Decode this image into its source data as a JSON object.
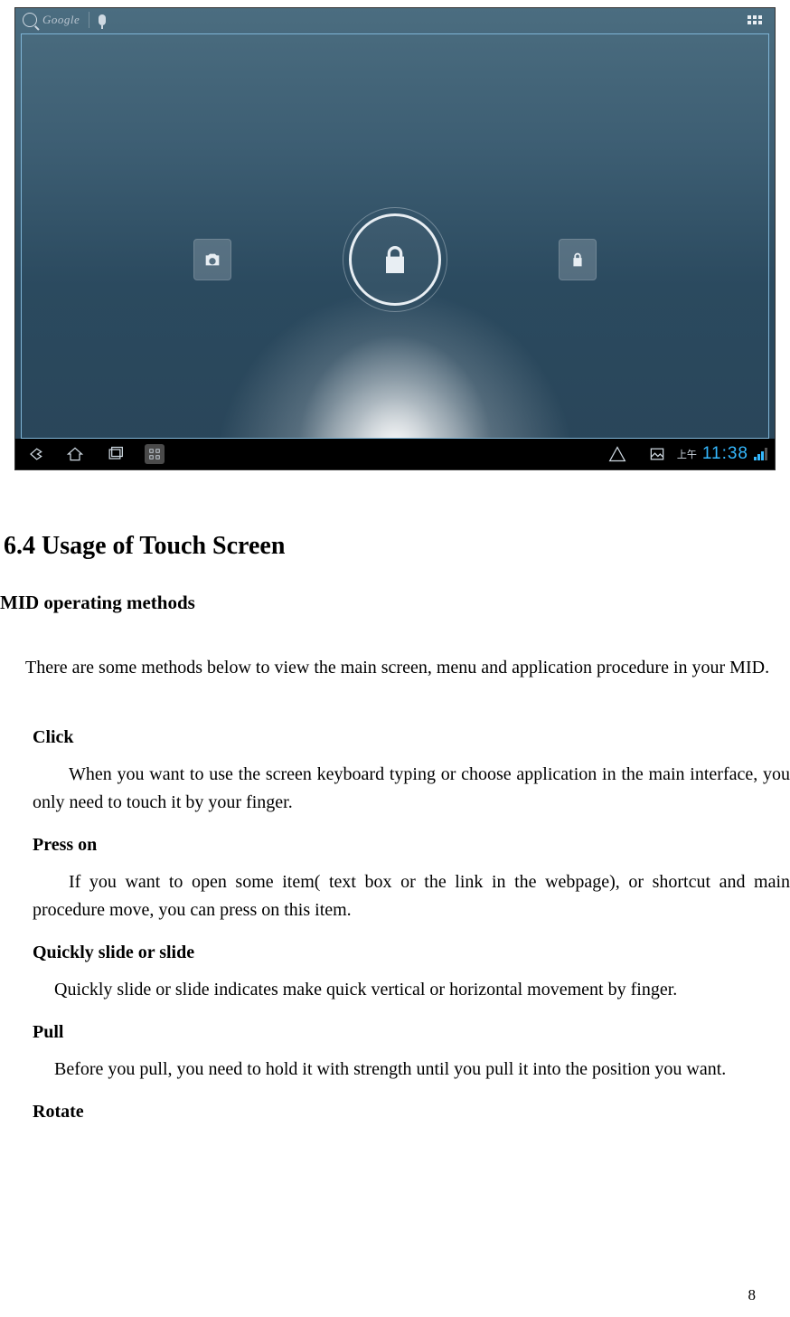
{
  "screenshot": {
    "search_brand": "Google",
    "clock_prefix": "上午",
    "time": "11:38"
  },
  "doc": {
    "section_title": "6.4 Usage of Touch Screen",
    "subheading": "MID operating methods",
    "intro": "There are some methods below to view the main screen, menu and application procedure in your MID.",
    "methods": [
      {
        "title": "Click",
        "body": "When you want to use the screen keyboard typing or choose application in the main interface, you only need to touch it by your finger."
      },
      {
        "title": "Press on",
        "body": "If you want to open some item( text box or the link in the webpage), or shortcut and main procedure move, you can press on this item."
      },
      {
        "title": "Quickly slide or slide",
        "body": "Quickly slide or slide indicates make quick vertical or horizontal movement by finger."
      },
      {
        "title": "Pull",
        "body": "Before you pull, you need to hold it with strength until you pull it into the position you want."
      },
      {
        "title": "Rotate",
        "body": ""
      }
    ],
    "page_number": "8"
  }
}
